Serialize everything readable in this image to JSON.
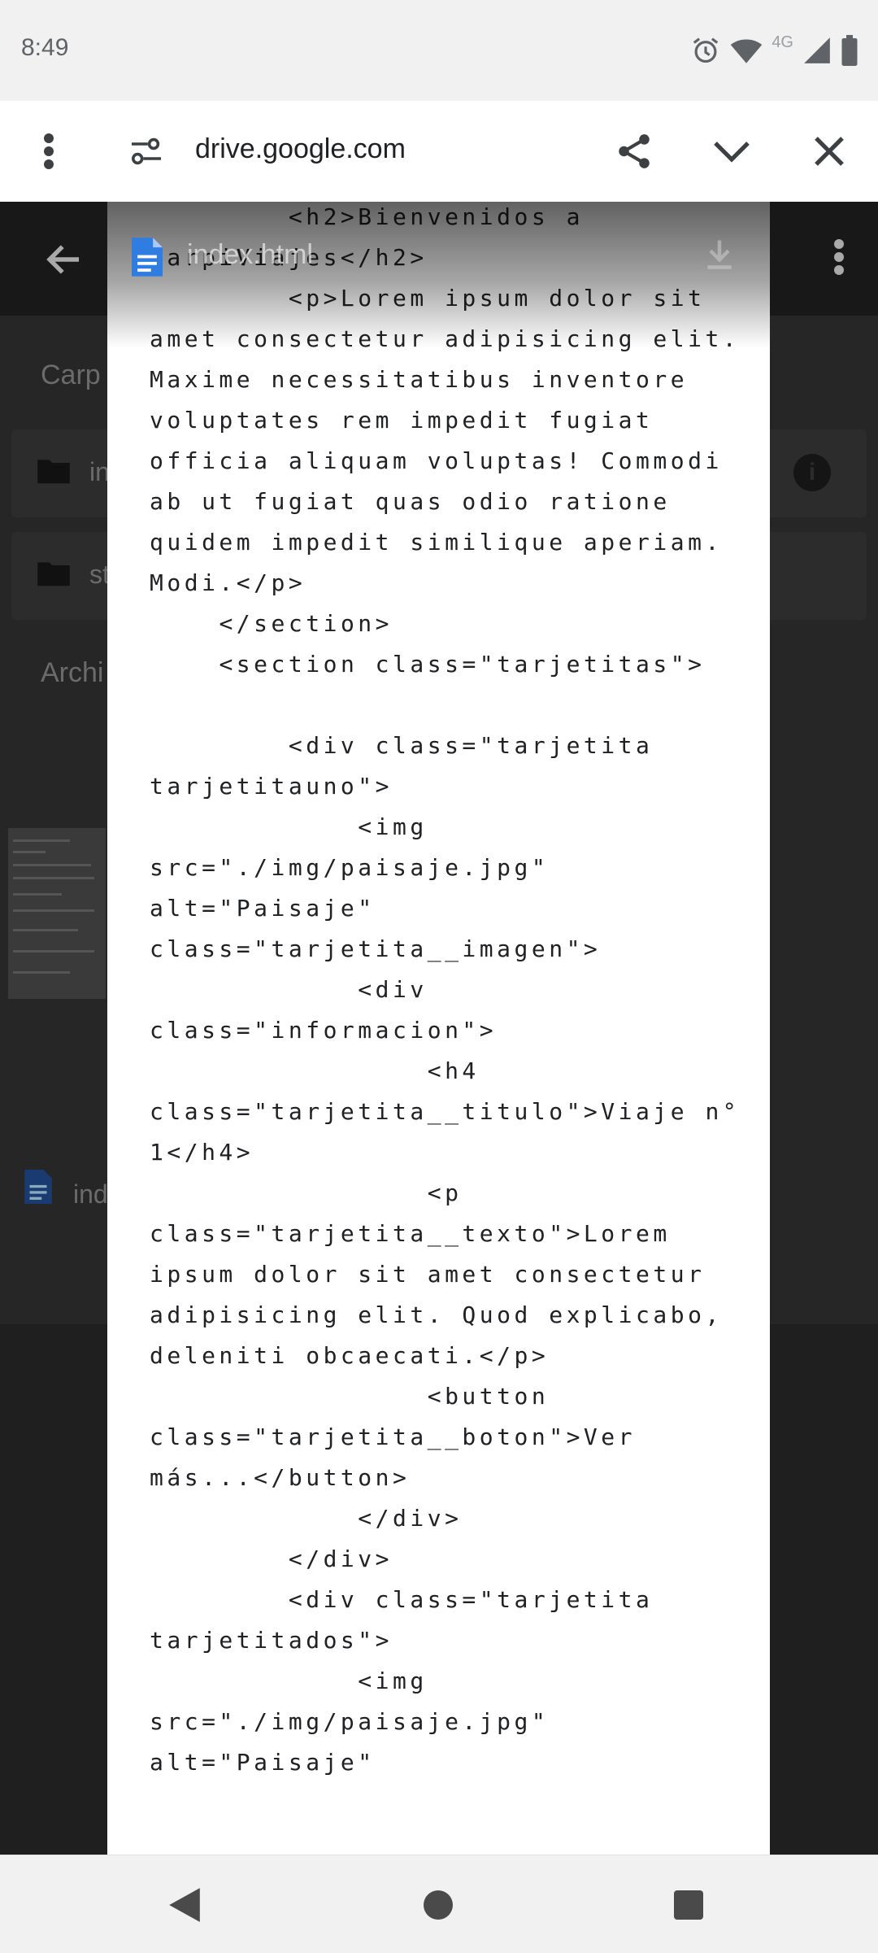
{
  "status_bar": {
    "time": "8:49",
    "network_label": "4G",
    "icons": [
      "alarm-icon",
      "wifi-icon",
      "cellular-signal-icon",
      "battery-icon"
    ]
  },
  "browser": {
    "url": "drive.google.com",
    "menu_icon": "more-vert-icon",
    "site_settings_icon": "page-info-icon",
    "share_icon": "share-icon",
    "minimize_icon": "chevron-down-icon",
    "close_icon": "close-icon"
  },
  "drive": {
    "section_folders": "Carp",
    "folders": [
      {
        "label": "in"
      },
      {
        "label": "st"
      }
    ],
    "section_files": "Archi",
    "file_label": "ind"
  },
  "preview": {
    "file_name": "index.html",
    "download_icon": "download-icon",
    "code_lines": [
      "        <h2>Bienvenidos a CarpiViajes</h2>",
      "        <p>Lorem ipsum dolor sit amet consectetur adipisicing elit. Maxime necessitatibus inventore voluptates rem impedit fugiat officia aliquam voluptas! Commodi ab ut fugiat quas odio ratione quidem impedit similique aperiam. Modi.</p>",
      "    </section>",
      "    <section class=\"tarjetitas\">",
      "",
      "        <div class=\"tarjetita tarjetitauno\">",
      "            <img src=\"./img/paisaje.jpg\" alt=\"Paisaje\" class=\"tarjetita__imagen\">",
      "            <div class=\"informacion\">",
      "                <h4 class=\"tarjetita__titulo\">Viaje n° 1</h4>",
      "                <p class=\"tarjetita__texto\">Lorem ipsum dolor sit amet consectetur adipisicing elit. Quod explicabo, deleniti obcaecati.</p>",
      "                <button class=\"tarjetita__boton\">Ver más...</button>",
      "            </div>",
      "        </div>",
      "        <div class=\"tarjetita tarjetitados\">",
      "            <img src=\"./img/paisaje.jpg\" alt=\"Paisaje\""
    ]
  },
  "navigation_bar": {
    "back_icon": "back-triangle-icon",
    "home_icon": "home-circle-icon",
    "recents_icon": "recents-square-icon"
  }
}
